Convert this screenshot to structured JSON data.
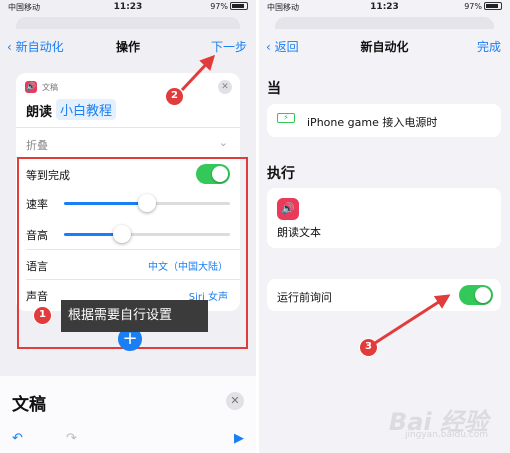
{
  "left_screen": {
    "status": {
      "carrier": "中国移动 ",
      "time": "11:23",
      "battery": "97%"
    },
    "nav": {
      "back": "新自动化",
      "title": "操作",
      "action": "下一步"
    },
    "action_card": {
      "app_name": "文稿",
      "verb": "朗读",
      "parameter": "小白教程",
      "collapse_label": "折叠",
      "wait_label": "等到完成",
      "wait_on": true,
      "rate_label": "速率",
      "rate_level": 0.5,
      "pitch_label": "音高",
      "pitch_level": 0.35,
      "language_label": "语言",
      "language_value": "中文（中国大陆）",
      "voice_label": "声音",
      "voice_value": "Siri 女声"
    },
    "tooltip": "根据需要自行设置",
    "bottom_panel": {
      "title": "文稿"
    }
  },
  "right_screen": {
    "status": {
      "carrier": "中国移动 ",
      "time": "11:23",
      "battery": "97%"
    },
    "nav": {
      "back": "返回",
      "title": "新自动化",
      "action": "完成"
    },
    "when_label": "当",
    "trigger": "iPhone game 接入电源时",
    "do_label": "执行",
    "action_name": "朗读文本",
    "ask_label": "运行前询问",
    "ask_on": true
  },
  "badges": [
    "1",
    "2",
    "3"
  ],
  "watermark": {
    "main": "Bai 经验",
    "sub": "jingyan.baidu.com"
  },
  "colors": {
    "accent": "#1a7ef4",
    "toggle": "#34c759",
    "highlight": "#e23b3b",
    "app_icon": "#ea3a5a"
  },
  "icons": [
    "chevron-left-icon",
    "close-icon",
    "chevron-down-icon",
    "plus-icon",
    "undo-icon",
    "redo-icon",
    "play-icon",
    "charging-icon",
    "speaker-icon"
  ]
}
